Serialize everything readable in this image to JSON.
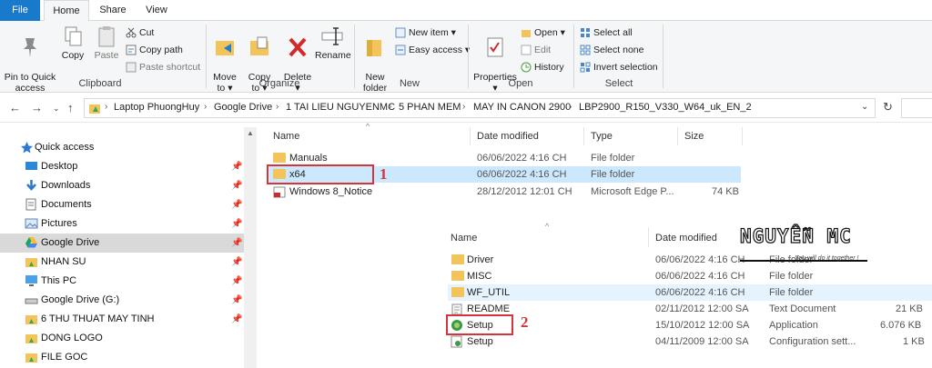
{
  "tabs": {
    "file": "File",
    "home": "Home",
    "share": "Share",
    "view": "View"
  },
  "ribbon": {
    "clipboard": {
      "label": "Clipboard",
      "pin": "Pin to Quick\naccess",
      "copy": "Copy",
      "paste": "Paste",
      "cut": "Cut",
      "copy_path": "Copy path",
      "paste_shortcut": "Paste shortcut"
    },
    "organize": {
      "label": "Organize",
      "move_to": "Move\nto ▾",
      "copy_to": "Copy\nto ▾",
      "delete": "Delete\n▾",
      "rename": "Rename"
    },
    "new": {
      "label": "New",
      "new_folder": "New\nfolder",
      "new_item": "New item ▾",
      "easy_access": "Easy access ▾"
    },
    "open": {
      "label": "Open",
      "properties": "Properties\n▾",
      "open": "Open ▾",
      "edit": "Edit",
      "history": "History"
    },
    "select": {
      "label": "Select",
      "select_all": "Select all",
      "select_none": "Select none",
      "invert": "Invert selection"
    }
  },
  "address": {
    "crumbs": [
      "Laptop PhuongHuy",
      "Google Drive",
      "1 TAI LIEU NGUYENMC",
      "5 PHAN MEM",
      "MAY IN CANON 2900",
      "LBP2900_R150_V330_W64_uk_EN_2"
    ]
  },
  "sidebar": {
    "items": [
      {
        "label": "Quick access"
      },
      {
        "label": "Desktop"
      },
      {
        "label": "Downloads"
      },
      {
        "label": "Documents"
      },
      {
        "label": "Pictures"
      },
      {
        "label": "Google Drive"
      },
      {
        "label": "NHAN SU"
      },
      {
        "label": "This PC"
      },
      {
        "label": "Google Drive (G:)"
      },
      {
        "label": "6 THU THUAT MAY TINH"
      },
      {
        "label": "DONG LOGO"
      },
      {
        "label": "FILE GOC"
      }
    ]
  },
  "list1": {
    "headers": {
      "name": "Name",
      "date": "Date modified",
      "type": "Type",
      "size": "Size"
    },
    "rows": [
      {
        "name": "Manuals",
        "date": "06/06/2022 4:16 CH",
        "type": "File folder",
        "size": ""
      },
      {
        "name": "x64",
        "date": "06/06/2022 4:16 CH",
        "type": "File folder",
        "size": ""
      },
      {
        "name": "Windows 8_Notice",
        "date": "28/12/2012 12:01 CH",
        "type": "Microsoft Edge P...",
        "size": "74 KB"
      }
    ]
  },
  "list2": {
    "headers": {
      "name": "Name",
      "date": "Date modified"
    },
    "rows": [
      {
        "name": "Driver",
        "date": "06/06/2022 4:16 CH",
        "type": "File folder",
        "size": ""
      },
      {
        "name": "MISC",
        "date": "06/06/2022 4:16 CH",
        "type": "File folder",
        "size": ""
      },
      {
        "name": "WF_UTIL",
        "date": "06/06/2022 4:16 CH",
        "type": "File folder",
        "size": ""
      },
      {
        "name": "README",
        "date": "02/11/2012 12:00 SA",
        "type": "Text Document",
        "size": "21 KB"
      },
      {
        "name": "Setup",
        "date": "15/10/2012 12:00 SA",
        "type": "Application",
        "size": "6.076 KB"
      },
      {
        "name": "Setup",
        "date": "04/11/2009 12:00 SA",
        "type": "Configuration sett...",
        "size": "1 KB"
      }
    ]
  },
  "annotations": {
    "one": "1",
    "two": "2"
  },
  "watermark": {
    "brand": "NGUYỄN MC",
    "tagline": "You will do it together !"
  }
}
